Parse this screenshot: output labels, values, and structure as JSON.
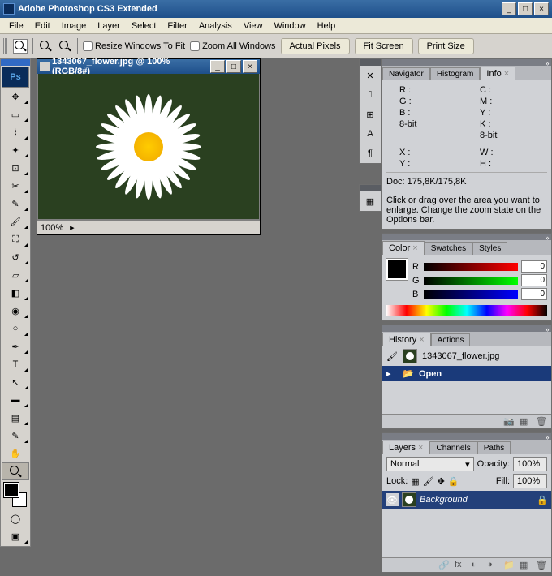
{
  "app": {
    "title": "Adobe Photoshop CS3 Extended"
  },
  "menu": [
    "File",
    "Edit",
    "Image",
    "Layer",
    "Select",
    "Filter",
    "Analysis",
    "View",
    "Window",
    "Help"
  ],
  "optbar": {
    "resize_windows": "Resize Windows To Fit",
    "zoom_all": "Zoom All Windows",
    "actual_pixels": "Actual Pixels",
    "fit_screen": "Fit Screen",
    "print_size": "Print Size"
  },
  "document": {
    "title": "1343067_flower.jpg @ 100% (RGB/8#)",
    "zoom": "100%"
  },
  "info_panel": {
    "tabs": [
      "Navigator",
      "Histogram",
      "Info"
    ],
    "r": "R :",
    "g": "G :",
    "b": "B :",
    "c": "C :",
    "m": "M :",
    "y": "Y :",
    "k": "K :",
    "bit1": "8-bit",
    "bit2": "8-bit",
    "x": "X :",
    "yy": "Y :",
    "w": "W :",
    "h": "H :",
    "doc": "Doc: 175,8K/175,8K",
    "hint": "Click or drag over the area you want to enlarge. Change the zoom state on the Options bar."
  },
  "color_panel": {
    "tabs": [
      "Color",
      "Swatches",
      "Styles"
    ],
    "r": "R",
    "g": "G",
    "b": "B",
    "rv": "0",
    "gv": "0",
    "bv": "0"
  },
  "history_panel": {
    "tabs": [
      "History",
      "Actions"
    ],
    "file": "1343067_flower.jpg",
    "open": "Open"
  },
  "layers_panel": {
    "tabs": [
      "Layers",
      "Channels",
      "Paths"
    ],
    "blend": "Normal",
    "opacity_lbl": "Opacity:",
    "opacity": "100%",
    "lock_lbl": "Lock:",
    "fill_lbl": "Fill:",
    "fill": "100%",
    "layer": "Background"
  }
}
